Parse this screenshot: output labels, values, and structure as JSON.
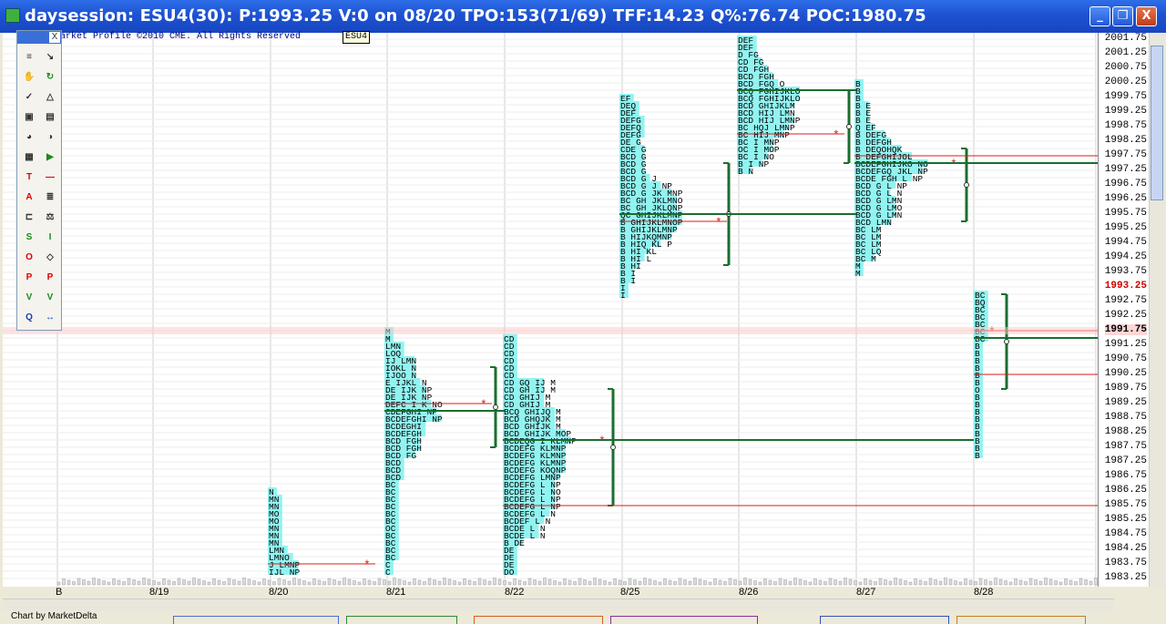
{
  "window": {
    "title": "daysession: ESU4(30): P:1993.25 V:0 on 08/20 TPO:153(71/69) TFF:14.23 Q%:76.74 POC:1980.75",
    "controls": {
      "minimize": "_",
      "maximize": "❐",
      "close": "X"
    }
  },
  "header": {
    "copyright": "arket Profile ©2010 CME. All Rights Reserved",
    "symbol": "ESU4"
  },
  "footer": {
    "credit": "Chart by MarketDelta"
  },
  "colors": {
    "profile": "#7ff2ef",
    "value_area_line": "#1a6e2e",
    "poc_line": "#d81e1e",
    "grid": "#cfcfcf",
    "title_bar": "#1d52d1"
  },
  "price_axis": {
    "labels": [
      "2001.75",
      "2001.25",
      "2000.75",
      "2000.25",
      "1999.75",
      "1999.25",
      "1998.75",
      "1998.25",
      "1997.75",
      "1997.25",
      "1996.75",
      "1996.25",
      "1995.75",
      "1995.25",
      "1994.75",
      "1994.25",
      "1993.75",
      "1993.25",
      "1992.75",
      "1992.25",
      "1991.75",
      "1991.25",
      "1990.75",
      "1990.25",
      "1989.75",
      "1989.25",
      "1988.75",
      "1988.25",
      "1987.75",
      "1987.25",
      "1986.75",
      "1986.25",
      "1985.75",
      "1985.25",
      "1984.75",
      "1984.25",
      "1983.75",
      "1983.25"
    ],
    "current_price": "1993.25",
    "highlight_price": "1991.75"
  },
  "date_axis": [
    "B",
    "8/19",
    "8/20",
    "8/21",
    "8/22",
    "8/25",
    "8/26",
    "8/27",
    "8/28"
  ],
  "toolbox": {
    "close": "X",
    "tools": [
      "list-icon",
      "arrow-icon",
      "hand-icon",
      "refresh-icon",
      "symbol-icon",
      "xyz-icon",
      "camera-icon",
      "notes-icon",
      "color-wheel-icon",
      "palette-icon",
      "grid-icon",
      "play-icon",
      "ts-icon",
      "line-icon",
      "text-icon",
      "bars-icon",
      "tpo-icon",
      "scale-icon",
      "sp-icon",
      "ib-icon",
      "or-icon",
      "diamond-icon",
      "poc-icon",
      "pocv-icon",
      "va-icon",
      "vavo-icon",
      "zoom-icon",
      "move-icon"
    ]
  },
  "chart_data": {
    "type": "market-profile",
    "instrument": "ESU4",
    "y_range": [
      1983.25,
      2001.75
    ],
    "tick": 0.25,
    "sessions": [
      {
        "date": "8/20",
        "low": 1983.25,
        "high": 1986.25,
        "poc": 1983.75,
        "rows": [
          {
            "price": 1986.25,
            "letters": "N"
          },
          {
            "price": 1986.0,
            "letters": "MN"
          },
          {
            "price": 1985.75,
            "letters": "MN"
          },
          {
            "price": 1985.5,
            "letters": "MO"
          },
          {
            "price": 1985.25,
            "letters": "MO"
          },
          {
            "price": 1985.0,
            "letters": "MN"
          },
          {
            "price": 1984.75,
            "letters": "MN"
          },
          {
            "price": 1984.5,
            "letters": "MN"
          },
          {
            "price": 1984.25,
            "letters": "LMN"
          },
          {
            "price": 1984.0,
            "letters": "LMNO"
          },
          {
            "price": 1983.75,
            "letters": "J LMNP"
          },
          {
            "price": 1983.5,
            "letters": "IJL NP"
          }
        ]
      },
      {
        "date": "8/21",
        "low": 1983.25,
        "high": 1991.75,
        "poc": 1989.25,
        "va_low": 1987.75,
        "va_high": 1990.5,
        "rows": [
          {
            "price": 1991.75,
            "letters": "M"
          },
          {
            "price": 1991.5,
            "letters": "M"
          },
          {
            "price": 1991.25,
            "letters": "LMN"
          },
          {
            "price": 1991.0,
            "letters": "LOQ"
          },
          {
            "price": 1990.75,
            "letters": "IJ LMN"
          },
          {
            "price": 1990.5,
            "letters": "IOKL N"
          },
          {
            "price": 1990.25,
            "letters": "IJOO N"
          },
          {
            "price": 1990.0,
            "letters": "E IJKL N"
          },
          {
            "price": 1989.75,
            "letters": "DE IJK NP"
          },
          {
            "price": 1989.5,
            "letters": "DE IJK NP"
          },
          {
            "price": 1989.25,
            "letters": "DEFC I K NO"
          },
          {
            "price": 1989.0,
            "letters": "CDEFGHI NP"
          },
          {
            "price": 1988.75,
            "letters": "BCDEFGHI NP"
          },
          {
            "price": 1988.5,
            "letters": "BCDEGHI"
          },
          {
            "price": 1988.25,
            "letters": "BCDEFGH"
          },
          {
            "price": 1988.0,
            "letters": "BCD FGH"
          },
          {
            "price": 1987.75,
            "letters": "BCD FGH"
          },
          {
            "price": 1987.5,
            "letters": "BCD FG"
          },
          {
            "price": 1987.25,
            "letters": "BCD"
          },
          {
            "price": 1987.0,
            "letters": "BCD"
          },
          {
            "price": 1986.75,
            "letters": "BCD"
          },
          {
            "price": 1986.5,
            "letters": "BC"
          },
          {
            "price": 1986.25,
            "letters": "BC"
          },
          {
            "price": 1986.0,
            "letters": "BC"
          },
          {
            "price": 1985.75,
            "letters": "BC"
          },
          {
            "price": 1985.5,
            "letters": "BC"
          },
          {
            "price": 1985.25,
            "letters": "BC"
          },
          {
            "price": 1985.0,
            "letters": "OC"
          },
          {
            "price": 1984.75,
            "letters": "BC"
          },
          {
            "price": 1984.5,
            "letters": "BC"
          },
          {
            "price": 1984.25,
            "letters": "BC"
          },
          {
            "price": 1984.0,
            "letters": "BC"
          },
          {
            "price": 1983.75,
            "letters": "C"
          },
          {
            "price": 1983.5,
            "letters": "C"
          }
        ]
      },
      {
        "date": "8/22",
        "low": 1983.25,
        "high": 1991.5,
        "poc": 1988.0,
        "va_low": 1985.75,
        "va_high": 1989.75,
        "rows": [
          {
            "price": 1991.5,
            "letters": "CD"
          },
          {
            "price": 1991.25,
            "letters": "CD"
          },
          {
            "price": 1991.0,
            "letters": "CD"
          },
          {
            "price": 1990.75,
            "letters": "CD"
          },
          {
            "price": 1990.5,
            "letters": "CD"
          },
          {
            "price": 1990.25,
            "letters": "CD"
          },
          {
            "price": 1990.0,
            "letters": "CD GQ IJ M"
          },
          {
            "price": 1989.75,
            "letters": "CD GH IJ M"
          },
          {
            "price": 1989.5,
            "letters": "CD GHIJ M"
          },
          {
            "price": 1989.25,
            "letters": "CD GHIJ M"
          },
          {
            "price": 1989.0,
            "letters": "BCQ GHIJQ M"
          },
          {
            "price": 1988.75,
            "letters": "BCD GHQJK M"
          },
          {
            "price": 1988.5,
            "letters": "BCD GHIJK M"
          },
          {
            "price": 1988.25,
            "letters": "BCD GHIJK MOP"
          },
          {
            "price": 1988.0,
            "letters": "BCDEQG I KLMNP"
          },
          {
            "price": 1987.75,
            "letters": "BCDEFG KLMNP"
          },
          {
            "price": 1987.5,
            "letters": "BCDEFG KLMNP"
          },
          {
            "price": 1987.25,
            "letters": "BCDEFG KLMNP"
          },
          {
            "price": 1987.0,
            "letters": "BCDEFG KOQNP"
          },
          {
            "price": 1986.75,
            "letters": "BCDEFG LMNP"
          },
          {
            "price": 1986.5,
            "letters": "BCDEFG L NP"
          },
          {
            "price": 1986.25,
            "letters": "BCDEFG L NO"
          },
          {
            "price": 1986.0,
            "letters": "BCDEFG L NP"
          },
          {
            "price": 1985.75,
            "letters": "BCDEFG L NP"
          },
          {
            "price": 1985.5,
            "letters": "BCDEFG L N"
          },
          {
            "price": 1985.25,
            "letters": "BCDEF L N"
          },
          {
            "price": 1985.0,
            "letters": "BCDE L N"
          },
          {
            "price": 1984.75,
            "letters": "BCDE L N"
          },
          {
            "price": 1984.5,
            "letters": "B DE"
          },
          {
            "price": 1984.25,
            "letters": "DE"
          },
          {
            "price": 1984.0,
            "letters": "DE"
          },
          {
            "price": 1983.75,
            "letters": "DE"
          },
          {
            "price": 1983.5,
            "letters": "DO"
          }
        ]
      },
      {
        "date": "8/25",
        "low": 1993.5,
        "high": 1999.75,
        "poc": 1995.5,
        "va_low": 1994.0,
        "va_high": 1997.5,
        "rows": [
          {
            "price": 1999.75,
            "letters": "EF"
          },
          {
            "price": 1999.5,
            "letters": "DEQ"
          },
          {
            "price": 1999.25,
            "letters": "DEF"
          },
          {
            "price": 1999.0,
            "letters": "DEFG"
          },
          {
            "price": 1998.75,
            "letters": "DEFQ"
          },
          {
            "price": 1998.5,
            "letters": "DEFG"
          },
          {
            "price": 1998.25,
            "letters": "DE G"
          },
          {
            "price": 1998.0,
            "letters": "CDE G"
          },
          {
            "price": 1997.75,
            "letters": "BCD G"
          },
          {
            "price": 1997.5,
            "letters": "BCD G"
          },
          {
            "price": 1997.25,
            "letters": "BCD G"
          },
          {
            "price": 1997.0,
            "letters": "BCD G J"
          },
          {
            "price": 1996.75,
            "letters": "BCD G J NP"
          },
          {
            "price": 1996.5,
            "letters": "BCD G JK MNP"
          },
          {
            "price": 1996.25,
            "letters": "BC GH JKLMNO"
          },
          {
            "price": 1996.0,
            "letters": "BC GH JKLQNP"
          },
          {
            "price": 1995.75,
            "letters": "QC GHIJKLMNP"
          },
          {
            "price": 1995.5,
            "letters": "B GHIJKLMNOP"
          },
          {
            "price": 1995.25,
            "letters": "B GHIJKLMNP"
          },
          {
            "price": 1995.0,
            "letters": "B HIJKQMNP"
          },
          {
            "price": 1994.75,
            "letters": "B HIQ KL P"
          },
          {
            "price": 1994.5,
            "letters": "B HI KL"
          },
          {
            "price": 1994.25,
            "letters": "B HI L"
          },
          {
            "price": 1994.0,
            "letters": "B HI"
          },
          {
            "price": 1993.75,
            "letters": "B I"
          },
          {
            "price": 1993.5,
            "letters": "B I"
          },
          {
            "price": 1993.25,
            "letters": "I"
          },
          {
            "price": 1993.0,
            "letters": "I"
          }
        ]
      },
      {
        "date": "8/26",
        "low": 1997.25,
        "high": 2001.75,
        "poc": 1998.5,
        "va_low": 1997.5,
        "va_high": 2000.0,
        "rows": [
          {
            "price": 2001.75,
            "letters": "DEF"
          },
          {
            "price": 2001.5,
            "letters": "DEF"
          },
          {
            "price": 2001.25,
            "letters": "D FG"
          },
          {
            "price": 2001.0,
            "letters": "CD FG"
          },
          {
            "price": 2000.75,
            "letters": "CD FGH"
          },
          {
            "price": 2000.5,
            "letters": "BCD FGH"
          },
          {
            "price": 2000.25,
            "letters": "BCD FGQ O"
          },
          {
            "price": 2000.0,
            "letters": "BCQ FGHIJKLO"
          },
          {
            "price": 1999.75,
            "letters": "BCQ FGHIJKLO"
          },
          {
            "price": 1999.5,
            "letters": "BCD GHIJKLM"
          },
          {
            "price": 1999.25,
            "letters": "BCD HIJ LMN"
          },
          {
            "price": 1999.0,
            "letters": "BCD HIJ LMNP"
          },
          {
            "price": 1998.75,
            "letters": "BC HQJ LMNP"
          },
          {
            "price": 1998.5,
            "letters": "BC HIJ MNP"
          },
          {
            "price": 1998.25,
            "letters": "BC I MNP"
          },
          {
            "price": 1998.0,
            "letters": "OC I MOP"
          },
          {
            "price": 1997.75,
            "letters": "BC I NO"
          },
          {
            "price": 1997.5,
            "letters": "B I NP"
          },
          {
            "price": 1997.25,
            "letters": "B N"
          }
        ]
      },
      {
        "date": "8/27",
        "low": 1993.75,
        "high": 2000.25,
        "poc": 1997.5,
        "va_low": 1995.5,
        "va_high": 1998.0,
        "rows": [
          {
            "price": 2000.25,
            "letters": "B"
          },
          {
            "price": 2000.0,
            "letters": "B"
          },
          {
            "price": 1999.75,
            "letters": "B"
          },
          {
            "price": 1999.5,
            "letters": "B E"
          },
          {
            "price": 1999.25,
            "letters": "B E"
          },
          {
            "price": 1999.0,
            "letters": "B E"
          },
          {
            "price": 1998.75,
            "letters": "Q EF"
          },
          {
            "price": 1998.5,
            "letters": "B DEFG"
          },
          {
            "price": 1998.25,
            "letters": "B DEFGH"
          },
          {
            "price": 1998.0,
            "letters": "B DEQOHQK"
          },
          {
            "price": 1997.75,
            "letters": "B DEFGHIJOL"
          },
          {
            "price": 1997.5,
            "letters": "BCDEFGHIJKO NO"
          },
          {
            "price": 1997.25,
            "letters": "BCDEFGQ JKL NP"
          },
          {
            "price": 1997.0,
            "letters": "BCDE FGH L NP"
          },
          {
            "price": 1996.75,
            "letters": "BCD G L NP"
          },
          {
            "price": 1996.5,
            "letters": "BCD G L N"
          },
          {
            "price": 1996.25,
            "letters": "BCD G LMN"
          },
          {
            "price": 1996.0,
            "letters": "BCD G LMO"
          },
          {
            "price": 1995.75,
            "letters": "BCD G LMN"
          },
          {
            "price": 1995.5,
            "letters": "BCD LMN"
          },
          {
            "price": 1995.25,
            "letters": "BC LM"
          },
          {
            "price": 1995.0,
            "letters": "BC LM"
          },
          {
            "price": 1994.75,
            "letters": "BC LM"
          },
          {
            "price": 1994.5,
            "letters": "BC LQ"
          },
          {
            "price": 1994.25,
            "letters": "BC M"
          },
          {
            "price": 1994.0,
            "letters": "M"
          },
          {
            "price": 1993.75,
            "letters": "M"
          }
        ]
      },
      {
        "date": "8/28",
        "low": 1987.5,
        "high": 1993.0,
        "poc": 1991.75,
        "va_low": 1989.75,
        "va_high": 1993.0,
        "rows": [
          {
            "price": 1993.0,
            "letters": "BC"
          },
          {
            "price": 1992.75,
            "letters": "BQ"
          },
          {
            "price": 1992.5,
            "letters": "BC"
          },
          {
            "price": 1992.25,
            "letters": "BC"
          },
          {
            "price": 1992.0,
            "letters": "BC"
          },
          {
            "price": 1991.75,
            "letters": "BC"
          },
          {
            "price": 1991.5,
            "letters": "BC"
          },
          {
            "price": 1991.25,
            "letters": "B"
          },
          {
            "price": 1991.0,
            "letters": "B"
          },
          {
            "price": 1990.75,
            "letters": "B"
          },
          {
            "price": 1990.5,
            "letters": "B"
          },
          {
            "price": 1990.25,
            "letters": "B"
          },
          {
            "price": 1990.0,
            "letters": "B"
          },
          {
            "price": 1989.75,
            "letters": "O"
          },
          {
            "price": 1989.5,
            "letters": "B"
          },
          {
            "price": 1989.25,
            "letters": "B"
          },
          {
            "price": 1989.0,
            "letters": "B"
          },
          {
            "price": 1988.75,
            "letters": "B"
          },
          {
            "price": 1988.5,
            "letters": "B"
          },
          {
            "price": 1988.25,
            "letters": "B"
          },
          {
            "price": 1988.0,
            "letters": "B"
          },
          {
            "price": 1987.75,
            "letters": "B"
          },
          {
            "price": 1987.5,
            "letters": "B"
          }
        ]
      }
    ]
  }
}
